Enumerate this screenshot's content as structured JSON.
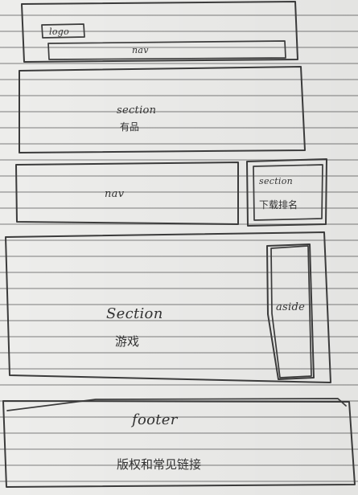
{
  "sections": {
    "header": {
      "logo": "logo",
      "nav": "nav"
    },
    "section1": {
      "title": "section",
      "subtitle": "有品"
    },
    "row3": {
      "nav": "nav",
      "section": "section",
      "subtitle": "下载排名"
    },
    "game": {
      "title": "Section",
      "subtitle": "游戏",
      "aside": "aside"
    },
    "footer": {
      "title": "footer",
      "subtitle": "版权和常见链接"
    }
  }
}
